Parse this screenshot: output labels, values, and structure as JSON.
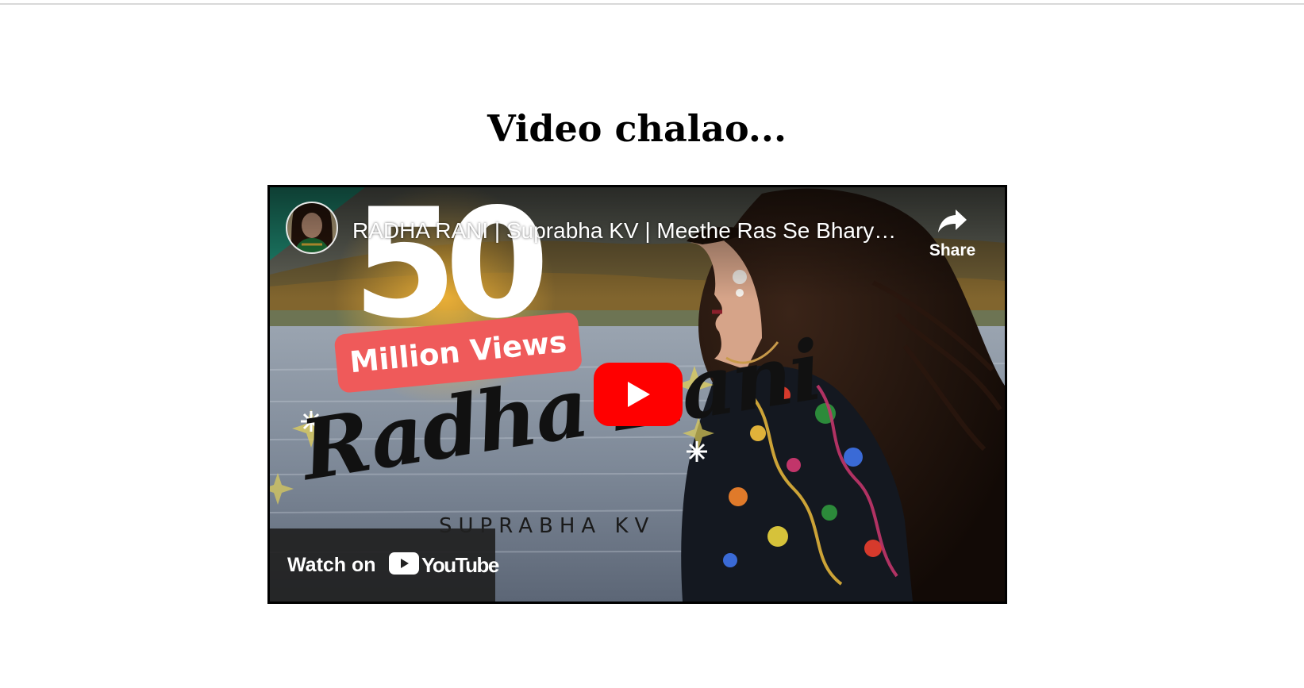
{
  "page": {
    "heading": "Video chalao..."
  },
  "video": {
    "title": "RADHA RANI | Suprabha KV | Meethe Ras Se Bhary…",
    "share_label": "Share",
    "watch_on_label": "Watch on",
    "youtube_wordmark": "YouTube",
    "thumbnail": {
      "big_number": "50",
      "badge_text": "Million Views",
      "script_title": "Radha Rani",
      "artist_name": "SUPRABHA KV"
    },
    "icons": {
      "share": "share-arrow-icon",
      "play": "youtube-play-icon",
      "logo": "youtube-logo-icon",
      "avatar": "channel-avatar"
    }
  },
  "colors": {
    "youtube_red": "#ff0000",
    "badge_red": "#ef5a5a",
    "corner_teal": "#1f8a72"
  }
}
